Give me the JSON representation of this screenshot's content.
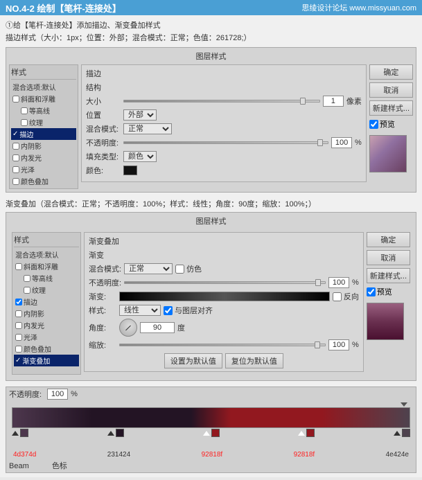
{
  "topbar": {
    "title": "NO.4-2 绘制【笔杆-连接处】",
    "site": "思绫设计论坛 www.missyuan.com"
  },
  "intro": {
    "step": "①给【笔杆-连接处】添加描边、渐变叠加样式",
    "stroke_desc": "描边样式（大小：1px；位置：外部；混合模式：正常；色值：261728;）",
    "gradient_desc": "渐变叠加（混合模式：正常；不透明度：100%；样式：线性；角度：90度；缩放：100%；）"
  },
  "dialog1": {
    "title": "图层样式",
    "styles_panel_title": "样式",
    "blend_option": "混合选项:默认",
    "style_items": [
      {
        "label": "斜面和浮雕",
        "checked": false
      },
      {
        "label": "等高线",
        "checked": false
      },
      {
        "label": "纹理",
        "checked": false
      },
      {
        "label": "描边",
        "checked": true,
        "active": true
      },
      {
        "label": "内阴影",
        "checked": false
      },
      {
        "label": "内发光",
        "checked": false
      },
      {
        "label": "光泽",
        "checked": false
      },
      {
        "label": "颜色叠加",
        "checked": false
      }
    ],
    "stroke_section": {
      "title": "描边",
      "structure_title": "结构",
      "size_label": "大小",
      "size_value": "1",
      "size_unit": "像素",
      "position_label": "位置",
      "position_value": "外部",
      "blend_label": "混合模式:",
      "blend_value": "正常",
      "opacity_label": "不透明度:",
      "opacity_value": "100",
      "opacity_unit": "%",
      "fill_type_label": "填充类型:",
      "fill_type_value": "颜色",
      "color_label": "颜色:"
    },
    "buttons": {
      "ok": "确定",
      "cancel": "取消",
      "new_style": "新建样式...",
      "preview_label": "预览"
    }
  },
  "dialog2": {
    "title": "图层样式",
    "styles_panel_title": "样式",
    "blend_option": "混合选项:默认",
    "style_items": [
      {
        "label": "斜面和浮雕",
        "checked": false
      },
      {
        "label": "等高线",
        "checked": false
      },
      {
        "label": "纹理",
        "checked": false
      },
      {
        "label": "描边",
        "checked": true
      },
      {
        "label": "内阴影",
        "checked": false
      },
      {
        "label": "内发光",
        "checked": false
      },
      {
        "label": "光泽",
        "checked": false
      },
      {
        "label": "颜色叠加",
        "checked": false
      },
      {
        "label": "渐变叠加",
        "checked": true,
        "active": true
      }
    ],
    "gradient_section": {
      "title": "渐变叠加",
      "sub_title": "渐变",
      "blend_label": "混合模式:",
      "blend_value": "正常",
      "dither_label": "仿色",
      "opacity_label": "不透明度:",
      "opacity_value": "100",
      "opacity_unit": "%",
      "gradient_label": "渐变:",
      "reverse_label": "反向",
      "style_label": "样式:",
      "style_value": "线性",
      "align_layer_label": "与图层对齐",
      "angle_label": "角度:",
      "angle_value": "90",
      "angle_unit": "度",
      "scale_label": "缩放:",
      "scale_value": "100",
      "scale_unit": "%"
    },
    "default_btns": {
      "set_default": "设置为默认值",
      "reset_default": "复位为默认值"
    },
    "buttons": {
      "ok": "确定",
      "cancel": "取消",
      "new_style": "新建样式...",
      "preview_label": "预览"
    }
  },
  "bottom_strip": {
    "opacity_label": "不透明度:",
    "opacity_value": "100",
    "opacity_unit": "%",
    "color_stops": [
      {
        "color": "#4d374d",
        "label": "4d374d",
        "position": 0
      },
      {
        "color": "#231424",
        "label": "231424",
        "position": 20
      },
      {
        "color": "#92181f",
        "label": "92818f",
        "position": 55
      },
      {
        "color": "#92181f",
        "label": "92818f",
        "position": 75
      },
      {
        "color": "#4e424e",
        "label": "4e424e",
        "position": 100
      }
    ],
    "beam_label": "Beam",
    "color_label": "色标"
  }
}
